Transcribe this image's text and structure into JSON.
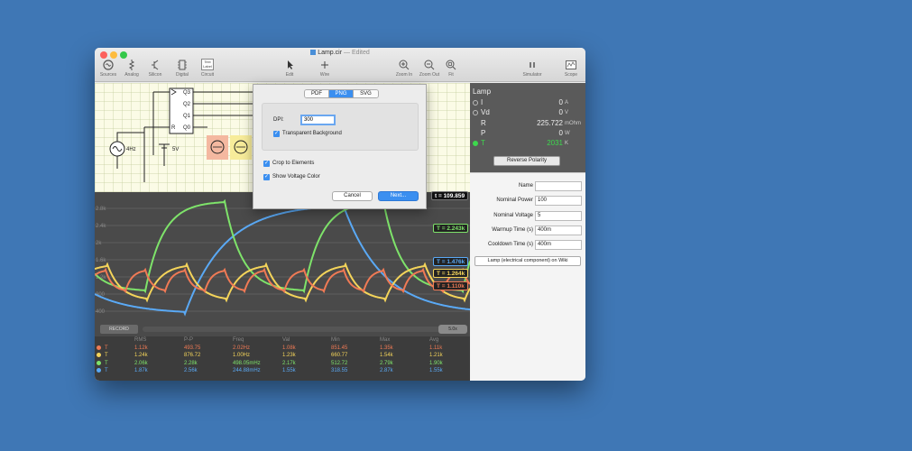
{
  "window": {
    "title": "Lamp.cir",
    "separator": "—",
    "status": "Edited"
  },
  "toolbar": {
    "sources": "Sources",
    "analog": "Analog",
    "silicon": "Silicon",
    "digital": "Digital",
    "circuit": "Circuit",
    "text_label_line1": "Text",
    "text_label_line2": "Label",
    "edit": "Edit",
    "wire": "Wire",
    "zoom_in": "Zoom In",
    "zoom_out": "Zoom Out",
    "fit": "Fit",
    "simulator": "Simulator",
    "scope": "Scope"
  },
  "circuit": {
    "pins": [
      "Q3",
      "Q2",
      "Q1",
      "Q0"
    ],
    "reset_pin": "R",
    "source_label": "4Hz",
    "battery_label": "5V"
  },
  "export_dialog": {
    "tabs": [
      "PDF",
      "PNG",
      "SVG"
    ],
    "active_tab": "PNG",
    "dpi_label": "DPI:",
    "dpi_value": "300",
    "transparent_label": "Transparent Background",
    "crop_label": "Crop to Elements",
    "voltage_color_label": "Show Voltage Color",
    "cancel": "Cancel",
    "next": "Next..."
  },
  "scope": {
    "time_label": "t = 109.859",
    "y_ticks": [
      "2.8k",
      "2.4k",
      "2k",
      "1.6k",
      "1.2k",
      "800",
      "400"
    ],
    "traces": [
      {
        "label": "T = 2.243k",
        "color": "#7ee36a"
      },
      {
        "label": "T = 1.476k",
        "color": "#5aa9f5"
      },
      {
        "label": "T = 1.264k",
        "color": "#f4d45a"
      },
      {
        "label": "T = 1.110k",
        "color": "#f07a55"
      }
    ],
    "record": "RECORD",
    "speed": "5.0x"
  },
  "stats": {
    "headers": [
      "RMS",
      "P-P",
      "Freq",
      "Val",
      "Min",
      "Max",
      "Avg"
    ],
    "rows": [
      {
        "name": "T",
        "color": "#f07a55",
        "values": [
          "1.12k",
          "493.75",
          "2.02Hz",
          "1.08k",
          "851.45",
          "1.35k",
          "1.11k"
        ]
      },
      {
        "name": "T",
        "color": "#f4d45a",
        "values": [
          "1.24k",
          "876.72",
          "1.00Hz",
          "1.23k",
          "660.77",
          "1.54k",
          "1.21k"
        ]
      },
      {
        "name": "T",
        "color": "#7ee36a",
        "values": [
          "2.06k",
          "2.28k",
          "498.05mHz",
          "2.17k",
          "512.72",
          "2.79k",
          "1.90k"
        ]
      },
      {
        "name": "T",
        "color": "#5aa9f5",
        "values": [
          "1.87k",
          "2.56k",
          "244.88mHz",
          "1.55k",
          "318.55",
          "2.87k",
          "1.55k"
        ]
      }
    ]
  },
  "inspector": {
    "title": "Lamp",
    "rows": [
      {
        "label": "I",
        "value": "0",
        "unit": "A"
      },
      {
        "label": "Vd",
        "value": "0",
        "unit": "V"
      },
      {
        "label": "R",
        "value": "225.722",
        "unit": "mOhm"
      },
      {
        "label": "P",
        "value": "0",
        "unit": "W"
      },
      {
        "label": "T",
        "value": "2031",
        "unit": "K"
      }
    ],
    "reverse_polarity": "Reverse Polarity"
  },
  "properties": {
    "rows": [
      {
        "label": "Name",
        "value": ""
      },
      {
        "label": "Nominal Power",
        "value": "100"
      },
      {
        "label": "Nominal Voltage",
        "value": "5"
      },
      {
        "label": "Warmup Time (s)",
        "value": "400m"
      },
      {
        "label": "Cooldown Time (s)",
        "value": "400m"
      }
    ],
    "wiki_button": "Lamp (electrical component) on Wiki"
  }
}
